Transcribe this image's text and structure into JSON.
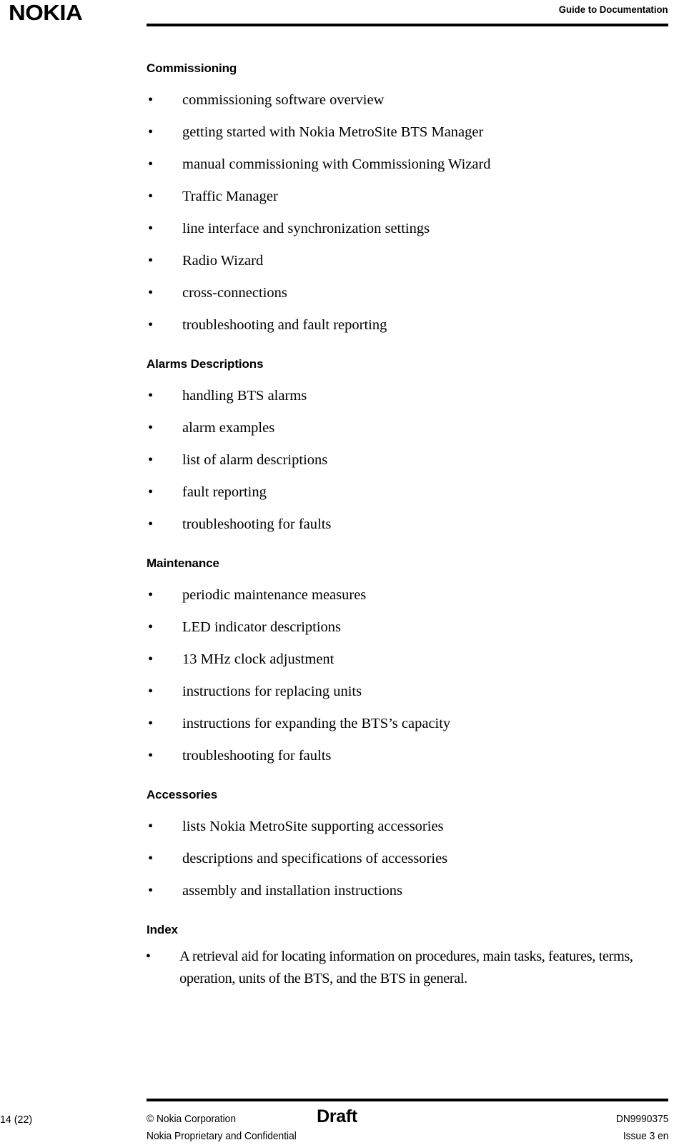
{
  "header": {
    "logo": "NOKIA",
    "title": "Guide to Documentation"
  },
  "sections": [
    {
      "heading": "Commissioning",
      "items": [
        "commissioning software overview",
        "getting started with Nokia MetroSite BTS Manager",
        "manual commissioning with Commissioning Wizard",
        "Traffic Manager",
        "line interface and synchronization settings",
        "Radio Wizard",
        "cross-connections",
        "troubleshooting and fault reporting"
      ]
    },
    {
      "heading": "Alarms Descriptions",
      "items": [
        "handling BTS alarms",
        "alarm examples",
        "list of alarm descriptions",
        "fault reporting",
        "troubleshooting for faults"
      ]
    },
    {
      "heading": "Maintenance",
      "items": [
        "periodic maintenance measures",
        "LED indicator descriptions",
        "13 MHz clock adjustment",
        "instructions for replacing units",
        "instructions for expanding the BTS’s capacity",
        "troubleshooting for faults"
      ]
    },
    {
      "heading": "Accessories",
      "items": [
        "lists Nokia MetroSite supporting accessories",
        "descriptions and specifications of accessories",
        "assembly and installation instructions"
      ]
    },
    {
      "heading": "Index",
      "items": [
        "A retrieval aid for locating information on procedures, main tasks, features, terms, operation, units of the BTS, and the BTS in general."
      ]
    }
  ],
  "bullet_glyph": "•",
  "footer": {
    "page_number": "14 (22)",
    "copyright": "© Nokia Corporation",
    "confidentiality": "Nokia Proprietary and Confidential",
    "status": "Draft",
    "document_id": "DN9990375",
    "issue": "Issue 3 en"
  }
}
